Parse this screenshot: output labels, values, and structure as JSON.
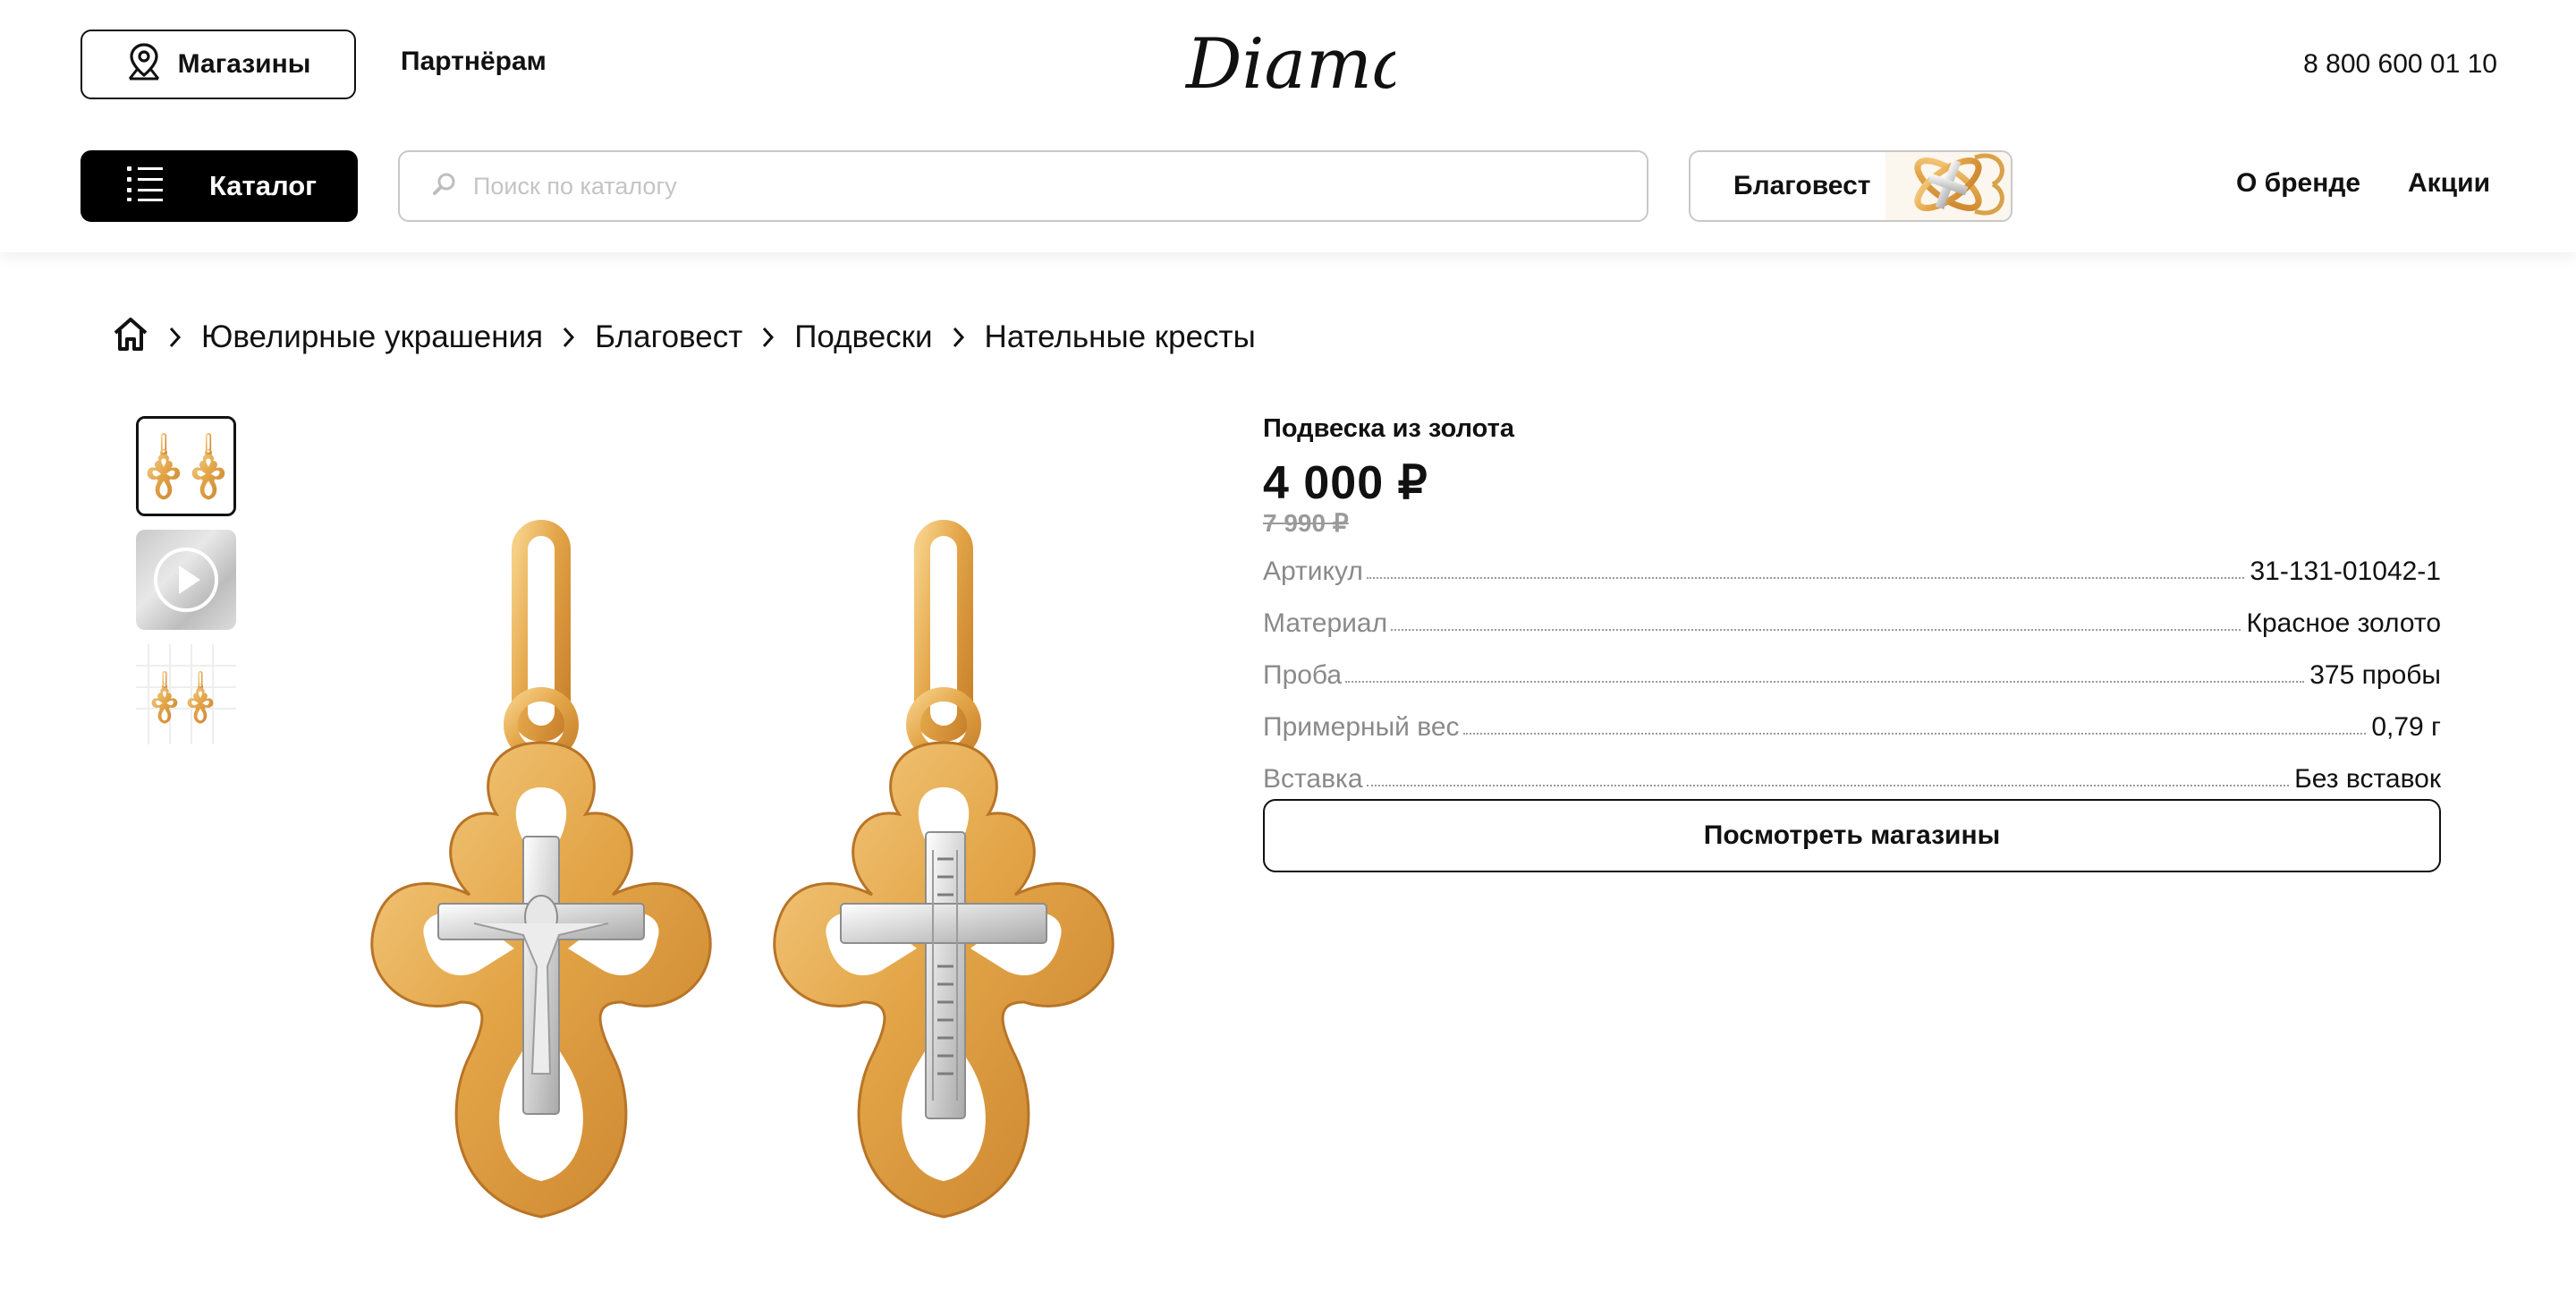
{
  "header": {
    "stores_label": "Магазины",
    "partners_label": "Партнёрам",
    "logo_text": "Diamant",
    "phone": "8 800 600 01 10",
    "catalog_label": "Каталог",
    "search_placeholder": "Поиск по каталогу",
    "brand_chip_label": "Благовест",
    "nav": [
      "О бренде",
      "Акции"
    ]
  },
  "breadcrumbs": [
    "Ювелирные украшения",
    "Благовест",
    "Подвески",
    "Нательные кресты"
  ],
  "product": {
    "title": "Подвеска из золота",
    "price": "4 000 ₽",
    "old_price": "7 990 ₽",
    "specs": [
      {
        "key": "Артикул",
        "value": "31-131-01042-1"
      },
      {
        "key": "Материал",
        "value": "Красное золото"
      },
      {
        "key": "Проба",
        "value": "375 пробы"
      },
      {
        "key": "Примерный вес",
        "value": "0,79 г"
      },
      {
        "key": "Вставка",
        "value": "Без вставок"
      }
    ],
    "view_stores_label": "Посмотреть магазины"
  },
  "colors": {
    "gold": "#E3A548",
    "silver": "#D9D9D9",
    "accent": "#000000"
  }
}
